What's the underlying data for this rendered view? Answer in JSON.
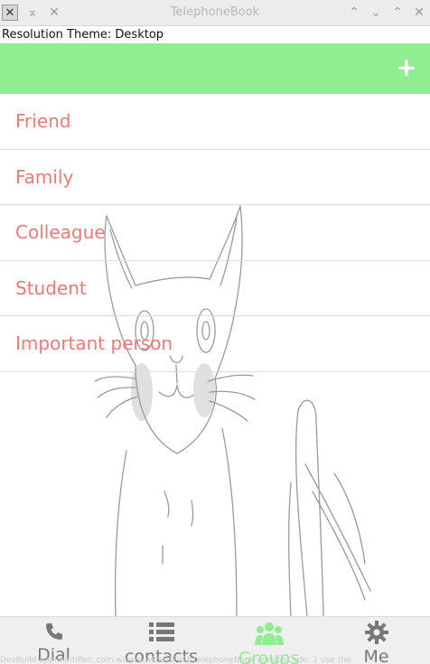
{
  "window": {
    "title": "TelephoneBook",
    "app_icon": "x11-app-icon",
    "left_buttons": [
      "shade-up-icon",
      "close-icon"
    ],
    "right_buttons": [
      "keep-above-icon",
      "keep-below-icon",
      "minimize-icon",
      "maximize-icon",
      "close-icon"
    ]
  },
  "resolution_line": "Resolution Theme: Desktop",
  "header": {
    "background": "#90ee90",
    "add_label": "+"
  },
  "groups": [
    {
      "label": "Friend"
    },
    {
      "label": "Family"
    },
    {
      "label": "Colleague"
    },
    {
      "label": "Student"
    },
    {
      "label": "Important person"
    }
  ],
  "tabs": [
    {
      "label": "Dial",
      "icon": "phone-icon",
      "active": false
    },
    {
      "label": "contacts",
      "icon": "list-icon",
      "active": false
    },
    {
      "label": "Groups",
      "icon": "people-icon",
      "active": true
    },
    {
      "label": "Me",
      "icon": "gear-icon",
      "active": false
    }
  ],
  "colors": {
    "accent_green": "#90ee90",
    "group_text": "#f07878",
    "tab_inactive": "#777777"
  },
  "footer_text": "DevBuild appIdentifier: com.wizard.wizardFVAP.telephoneBook versionCode: 1 use the"
}
